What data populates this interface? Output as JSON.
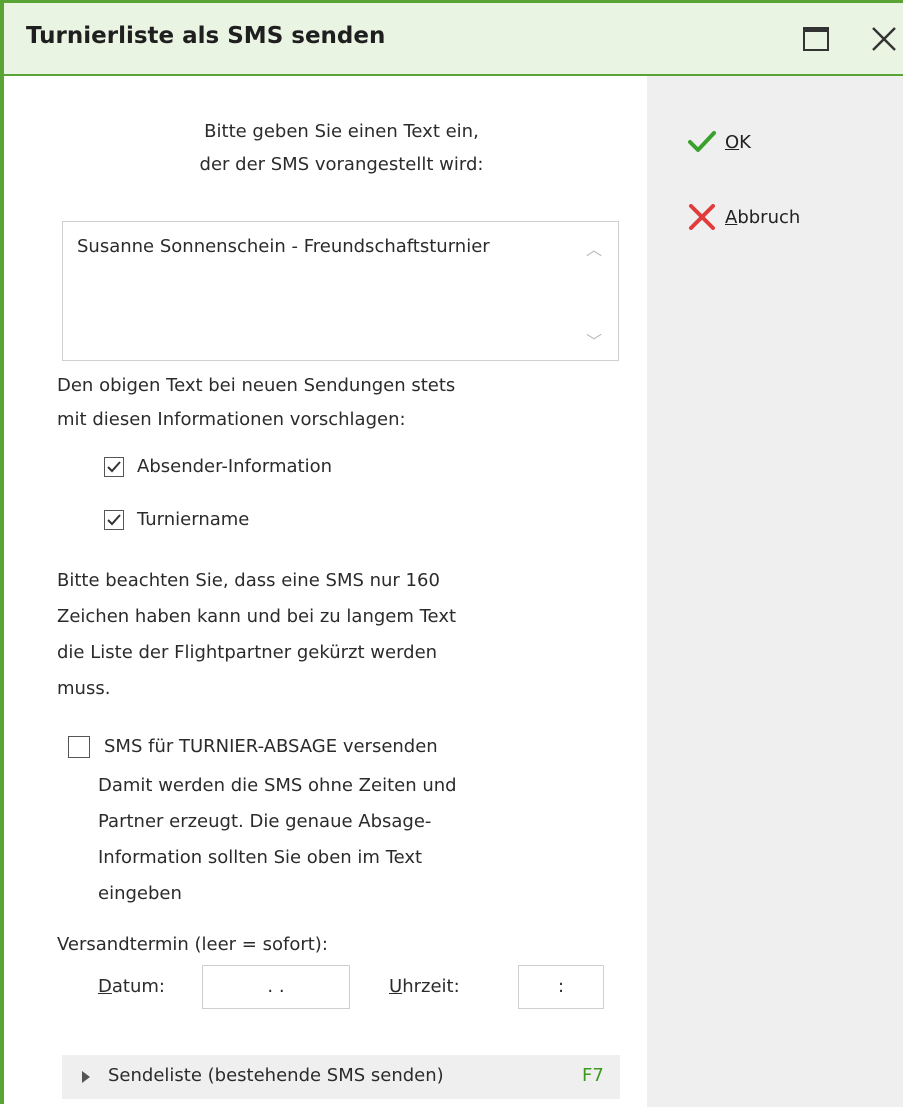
{
  "window": {
    "title": "Turnierliste als SMS senden"
  },
  "prompt": {
    "line1": "Bitte geben Sie einen Text ein,",
    "line2": "der der SMS vorangestellt wird:"
  },
  "message_text": "Susanne Sonnenschein - Freundschaftsturnier",
  "suggest": {
    "line1": "Den obigen Text bei neuen Sendungen stets",
    "line2": "mit diesen Informationen vorschlagen:",
    "options": [
      {
        "label": "Absender-Information",
        "checked": true
      },
      {
        "label": "Turniername",
        "checked": true
      }
    ]
  },
  "notice": {
    "line1": "Bitte beachten Sie, dass eine SMS nur 160",
    "line2": "Zeichen haben kann und bei zu langem Text",
    "line3": "die Liste der Flightpartner gekürzt werden",
    "line4": "muss."
  },
  "cancel_option": {
    "label": "SMS für TURNIER-ABSAGE versenden",
    "checked": false,
    "desc1": "Damit werden die SMS ohne Zeiten und",
    "desc2": "Partner erzeugt. Die genaue Absage-",
    "desc3": "Information sollten Sie oben im Text",
    "desc4": "eingeben"
  },
  "schedule": {
    "heading": "Versandtermin (leer = sofort):",
    "date_label_first": "D",
    "date_label_rest": "atum:",
    "date_value": ". .",
    "time_label_first": "U",
    "time_label_rest": "hrzeit:",
    "time_value": ":"
  },
  "sendlist": {
    "label": "Sendeliste (bestehende SMS senden)",
    "shortcut": "F7"
  },
  "actions": {
    "ok_first": "O",
    "ok_rest": "K",
    "cancel_first": "A",
    "cancel_rest": "bbruch"
  },
  "colors": {
    "accent": "#5aa335",
    "title_bg": "#eaf4e3",
    "ok_icon": "#3aa12f",
    "cancel_icon": "#e23b3b"
  }
}
